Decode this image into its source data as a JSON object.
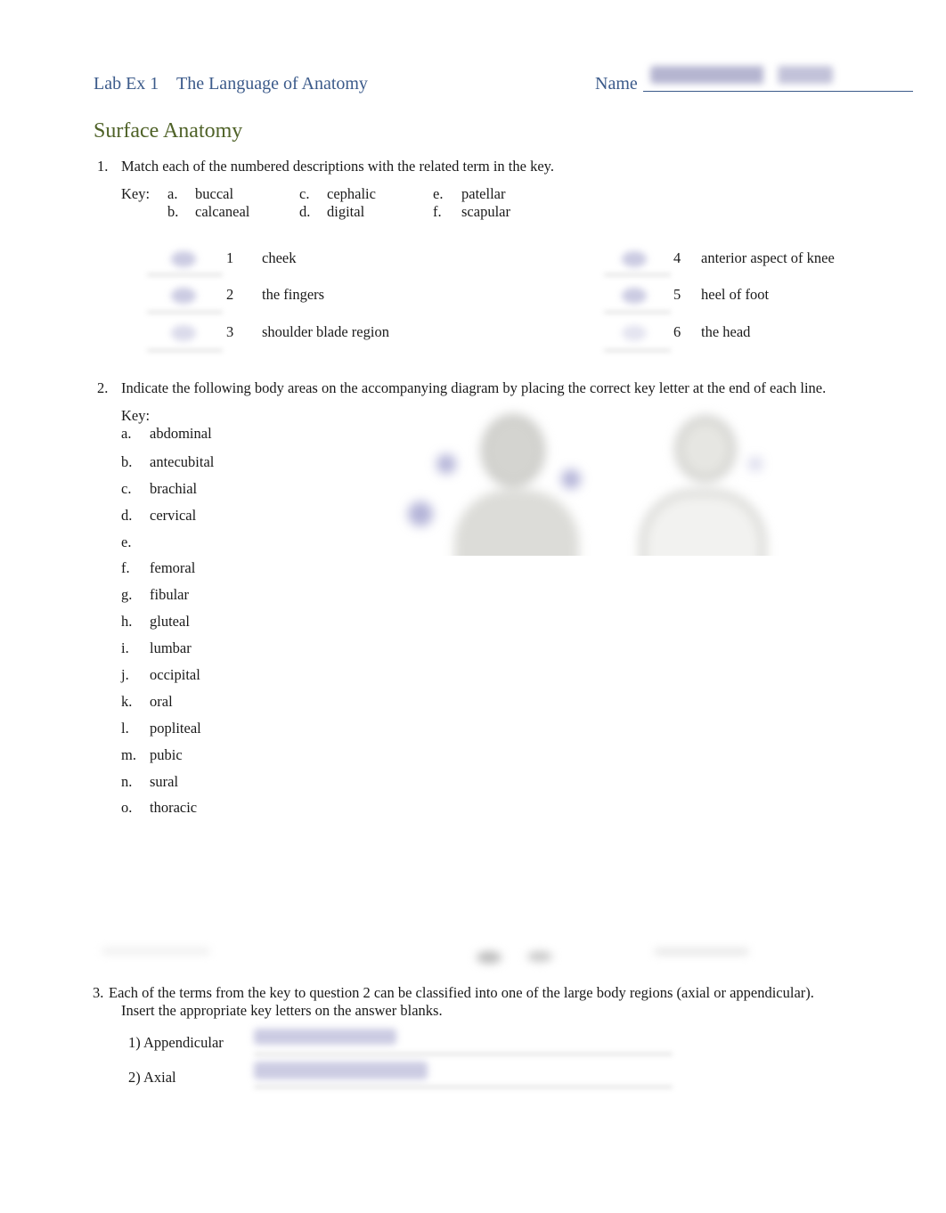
{
  "header": {
    "lab_label": "Lab Ex 1",
    "title": "The Language of Anatomy",
    "name_label": "Name"
  },
  "section_title": "Surface Anatomy",
  "q1": {
    "number": "1.",
    "prompt": "Match each of the numbered descriptions with the related term in the key.",
    "key_label": "Key:",
    "key": [
      {
        "letter": "a.",
        "term": "buccal"
      },
      {
        "letter": "b.",
        "term": "calcaneal"
      },
      {
        "letter": "c.",
        "term": "cephalic"
      },
      {
        "letter": "d.",
        "term": "digital"
      },
      {
        "letter": "e.",
        "term": "patellar"
      },
      {
        "letter": "f.",
        "term": "scapular"
      }
    ],
    "items": [
      {
        "num": "1",
        "text": "cheek"
      },
      {
        "num": "2",
        "text": "the fingers"
      },
      {
        "num": "3",
        "text": "shoulder blade region"
      },
      {
        "num": "4",
        "text": "anterior aspect of knee"
      },
      {
        "num": "5",
        "text": "heel of foot"
      },
      {
        "num": "6",
        "text": "the head"
      }
    ]
  },
  "q2": {
    "number": "2.",
    "prompt": "Indicate the following body areas on the accompanying diagram by placing the correct key letter at the end of each line.",
    "key_label": "Key:",
    "key": [
      {
        "letter": "a.",
        "term": "abdominal"
      },
      {
        "letter": "b.",
        "term": "antecubital"
      },
      {
        "letter": "c.",
        "term": "brachial"
      },
      {
        "letter": "d.",
        "term": "cervical"
      },
      {
        "letter": "e.",
        "term": ""
      },
      {
        "letter": "f.",
        "term": "femoral"
      },
      {
        "letter": "g.",
        "term": "fibular"
      },
      {
        "letter": "h.",
        "term": "gluteal"
      },
      {
        "letter": "i.",
        "term": "lumbar"
      },
      {
        "letter": "j.",
        "term": "occipital"
      },
      {
        "letter": "k.",
        "term": "oral"
      },
      {
        "letter": "l.",
        "term": "popliteal"
      },
      {
        "letter": "m.",
        "term": "pubic"
      },
      {
        "letter": "n.",
        "term": "sural"
      },
      {
        "letter": "o.",
        "term": "thoracic"
      }
    ]
  },
  "q3": {
    "number": "3.",
    "prompt_line1": "Each of the terms from the key to question 2 can be classified into one of the large body regions (axial or appendicular).",
    "prompt_line2": "Insert the appropriate key letters on the answer blanks.",
    "answers": [
      {
        "label": "1) Appendicular"
      },
      {
        "label": "2) Axial"
      }
    ]
  }
}
